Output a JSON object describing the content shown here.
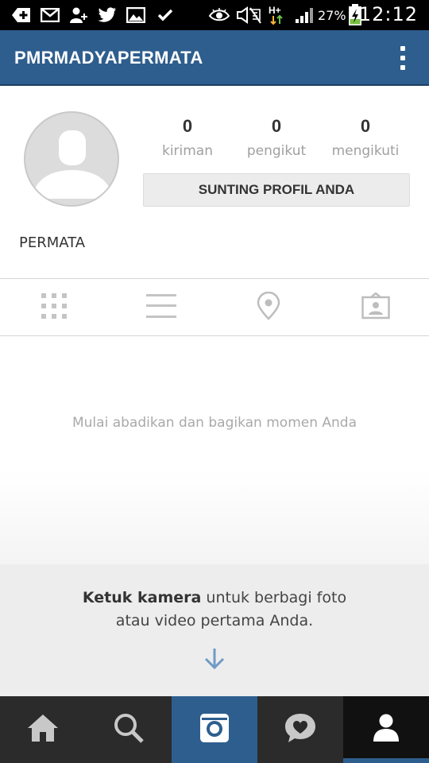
{
  "status_bar": {
    "battery_percent": "27%",
    "time": "12:12",
    "icons": [
      "add-icon",
      "mail-icon",
      "add-contact-icon",
      "twitter-icon",
      "gallery-icon",
      "check-icon",
      "eye-icon",
      "mute-icon",
      "hplus-icon",
      "signal-icon",
      "battery-charging-icon"
    ]
  },
  "header": {
    "title": "PMRMADYAPERMATA",
    "menu_icon": "overflow-menu-icon"
  },
  "profile": {
    "avatar_icon": "default-avatar-icon",
    "stats": [
      {
        "value": "0",
        "label": "kiriman"
      },
      {
        "value": "0",
        "label": "pengikut"
      },
      {
        "value": "0",
        "label": "mengikuti"
      }
    ],
    "edit_button_label": "SUNTING PROFIL ANDA",
    "name": "PERMATA"
  },
  "view_tabs": [
    {
      "name": "grid",
      "icon": "grid-icon"
    },
    {
      "name": "list",
      "icon": "list-icon"
    },
    {
      "name": "map",
      "icon": "location-pin-icon"
    },
    {
      "name": "tagged",
      "icon": "tagged-photos-icon"
    }
  ],
  "empty_state": {
    "message": "Mulai abadikan dan bagikan momen Anda"
  },
  "hint": {
    "bold_text": "Ketuk kamera",
    "text_line1_rest": " untuk berbagi foto",
    "text_line2": "atau video pertama Anda.",
    "arrow_icon": "arrow-down-icon"
  },
  "bottom_nav": [
    {
      "name": "home",
      "icon": "home-icon"
    },
    {
      "name": "search",
      "icon": "search-icon"
    },
    {
      "name": "camera",
      "icon": "camera-icon"
    },
    {
      "name": "activity",
      "icon": "activity-heart-icon"
    },
    {
      "name": "profile",
      "icon": "profile-icon",
      "active": true
    }
  ],
  "colors": {
    "header_bg": "#2e5e8e",
    "bottom_nav_bg": "#2b2b2b",
    "accent": "#2e5e8e"
  }
}
